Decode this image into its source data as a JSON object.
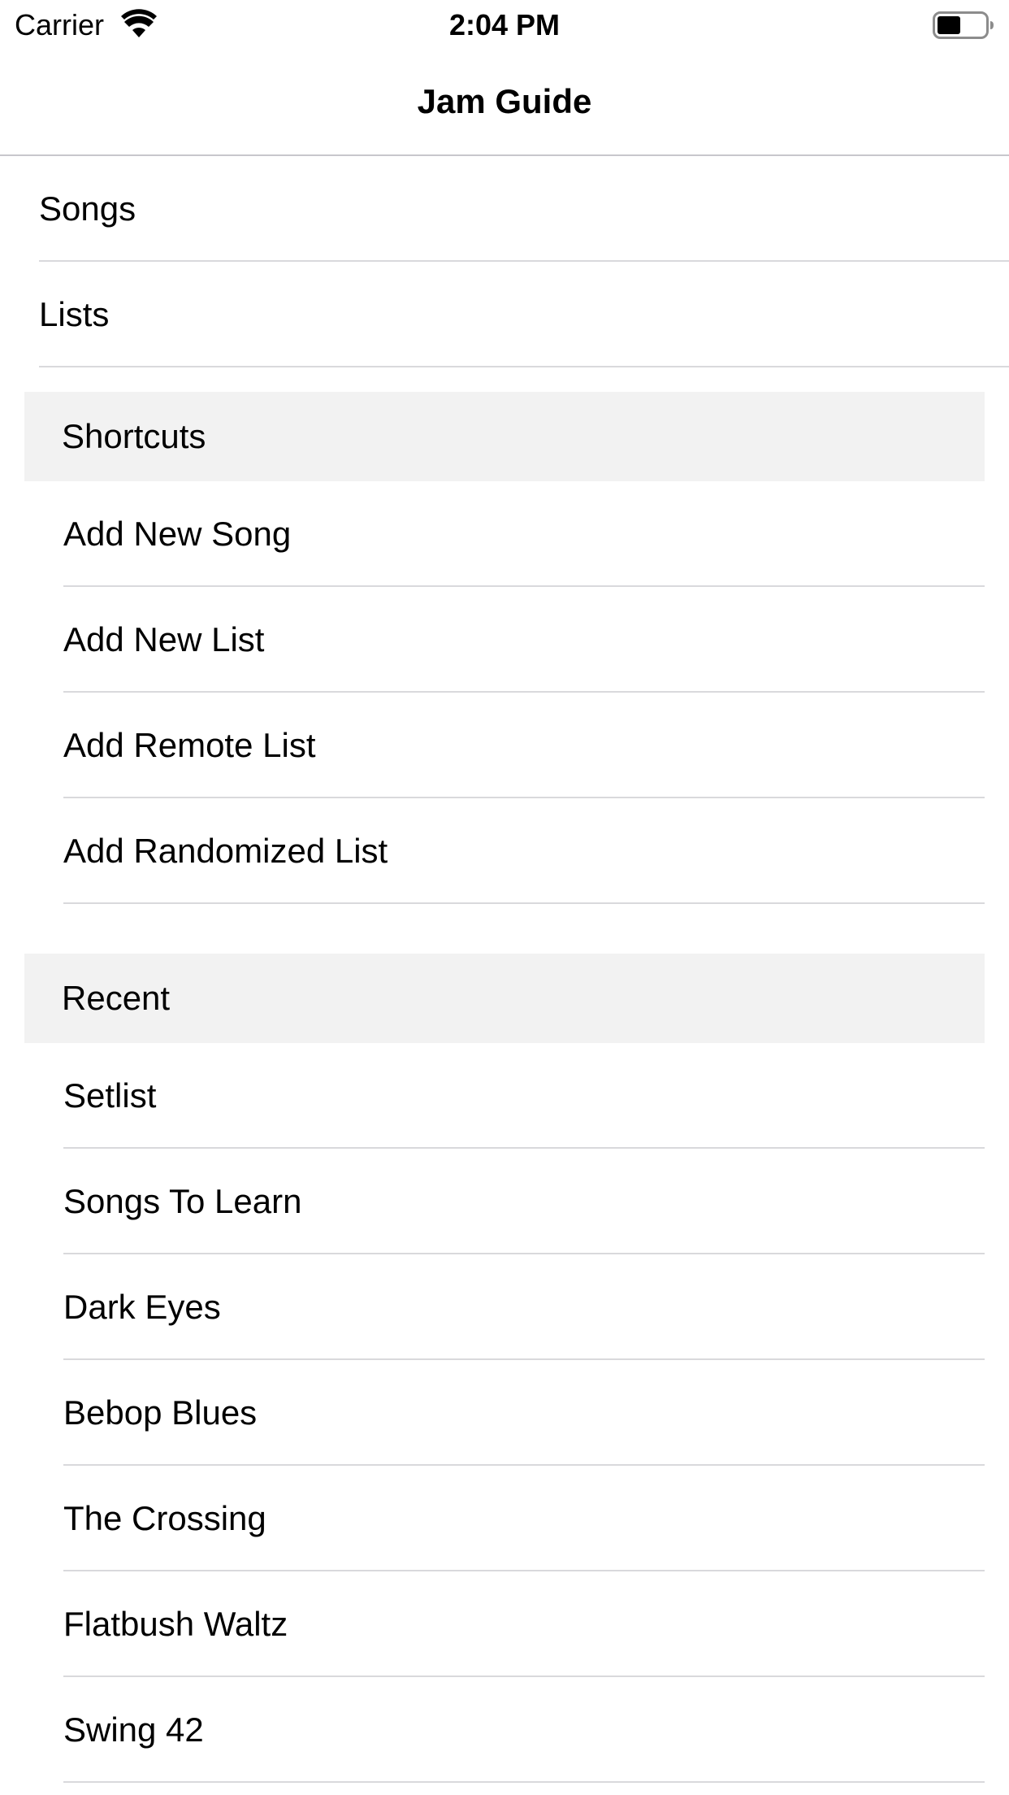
{
  "status_bar": {
    "carrier": "Carrier",
    "time": "2:04 PM",
    "icons": [
      "wifi-icon",
      "battery-icon"
    ]
  },
  "nav": {
    "title": "Jam Guide"
  },
  "top_items": [
    {
      "label": "Songs"
    },
    {
      "label": "Lists"
    }
  ],
  "sections": {
    "shortcuts": {
      "header": "Shortcuts",
      "items": [
        {
          "label": "Add New Song"
        },
        {
          "label": "Add New List"
        },
        {
          "label": "Add Remote List"
        },
        {
          "label": "Add Randomized List"
        }
      ]
    },
    "recent": {
      "header": "Recent",
      "items": [
        {
          "label": "Setlist"
        },
        {
          "label": "Songs To Learn"
        },
        {
          "label": "Dark Eyes"
        },
        {
          "label": "Bebop Blues"
        },
        {
          "label": "The Crossing"
        },
        {
          "label": "Flatbush Waltz"
        },
        {
          "label": "Swing 42"
        }
      ]
    }
  }
}
